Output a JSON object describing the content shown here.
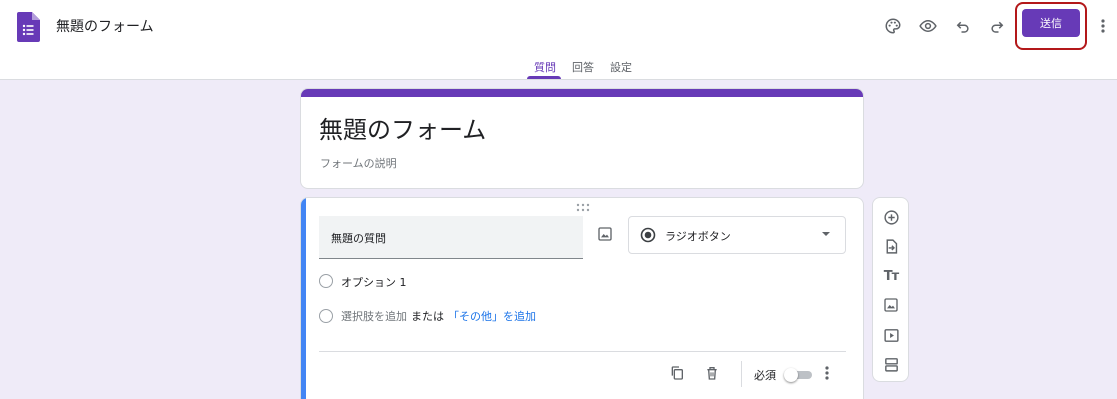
{
  "header": {
    "doc_title": "無題のフォーム",
    "send_label": "送信",
    "icons": [
      "palette-icon",
      "preview-eye-icon",
      "undo-icon",
      "redo-icon",
      "more-vert-icon"
    ]
  },
  "tabs": [
    {
      "label": "質問",
      "active": true
    },
    {
      "label": "回答",
      "active": false
    },
    {
      "label": "設定",
      "active": false
    }
  ],
  "form": {
    "title": "無題のフォーム",
    "description_placeholder": "フォームの説明"
  },
  "question": {
    "title": "無題の質問",
    "type": "ラジオボタン",
    "options": [
      "オプション 1"
    ],
    "add_option": "選択肢を追加",
    "or_text": "または",
    "add_other": "「その他」を追加",
    "required_label": "必須",
    "required": false
  },
  "side_toolbar": [
    "add-question-icon",
    "import-questions-icon",
    "add-title-icon",
    "add-image-icon",
    "add-video-icon",
    "add-section-icon"
  ],
  "colors": {
    "theme": "#673ab7",
    "background": "#efebf8",
    "active_accent": "#4285f4",
    "link": "#1a73e8",
    "highlight_box": "#b3181a"
  }
}
